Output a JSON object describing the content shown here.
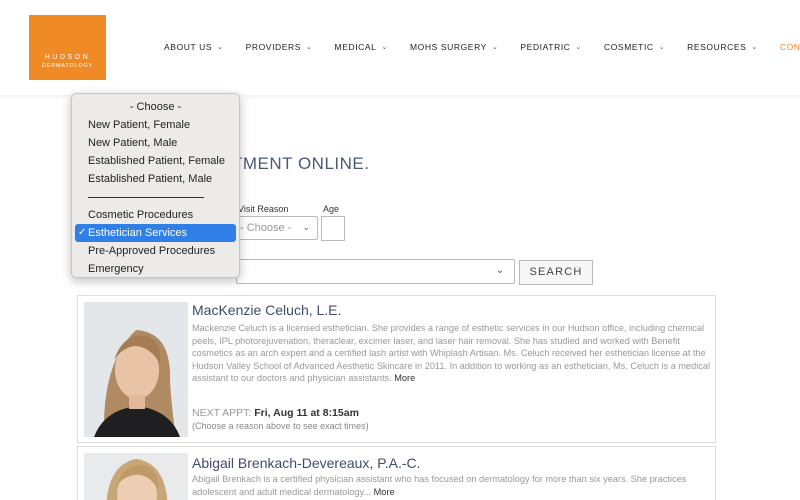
{
  "brand": {
    "line1": "HUDSON",
    "line2": "DERMATOLOGY",
    "color": "#f08a24"
  },
  "nav": {
    "items": [
      {
        "label": "ABOUT US",
        "active": false
      },
      {
        "label": "PROVIDERS",
        "active": false
      },
      {
        "label": "MEDICAL",
        "active": false
      },
      {
        "label": "MOHS SURGERY",
        "active": false
      },
      {
        "label": "PEDIATRIC",
        "active": false
      },
      {
        "label": "COSMETIC",
        "active": false
      },
      {
        "label": "RESOURCES",
        "active": false
      },
      {
        "label": "CONTACT",
        "active": true
      }
    ],
    "caret_icon": "chevron-down-icon"
  },
  "heading": "TMENT ONLINE.",
  "form": {
    "visit_reason_label": "Visit Reason",
    "visit_reason_value": "- Choose -",
    "age_label": "Age",
    "age_value": "",
    "search_label": "SEARCH"
  },
  "dropdown": {
    "options": [
      {
        "label": "- Choose -",
        "type": "header"
      },
      {
        "label": "New Patient, Female",
        "type": "option"
      },
      {
        "label": "New Patient, Male",
        "type": "option"
      },
      {
        "label": "Established Patient, Female",
        "type": "option"
      },
      {
        "label": "Established Patient, Male",
        "type": "option"
      },
      {
        "label": "",
        "type": "separator"
      },
      {
        "label": "Cosmetic Procedures",
        "type": "option"
      },
      {
        "label": "Esthetician Services",
        "type": "option",
        "selected": true
      },
      {
        "label": "Pre-Approved Procedures",
        "type": "option"
      },
      {
        "label": "Emergency",
        "type": "option"
      }
    ],
    "selected_color": "#2f7fe6"
  },
  "providers": [
    {
      "name": "MacKenzie Celuch, L.E.",
      "bio": "Mackenzie Celuch is a licensed esthetician. She provides a range of esthetic services in our Hudson office, including chemical peels, IPL photorejuvenation, theraclear, excimer laser, and laser hair removal. She has studied and worked with Benefit cosmetics as an arch expert and a certified lash artist with Whiplash Artisan. Ms. Celuch received her esthetician license at the Hudson Valley School of Advanced Aesthetic Skincare in 2011. In addition to working as an esthetician, Ms. Celuch is a medical assistant to our doctors and physician assistants.",
      "more": "More",
      "next_appt_label": "NEXT APPT:",
      "next_appt_value": "Fri, Aug 11 at 8:15am",
      "note": "(Choose a reason above to see exact times)"
    },
    {
      "name": "Abigail Brenkach-Devereaux, P.A.-C.",
      "bio": "Abigail Brenkach is a certified physician assistant who has focused on dermatology for more than six years. She practices adolescent and adult medical dermatology...",
      "more": "More"
    }
  ]
}
